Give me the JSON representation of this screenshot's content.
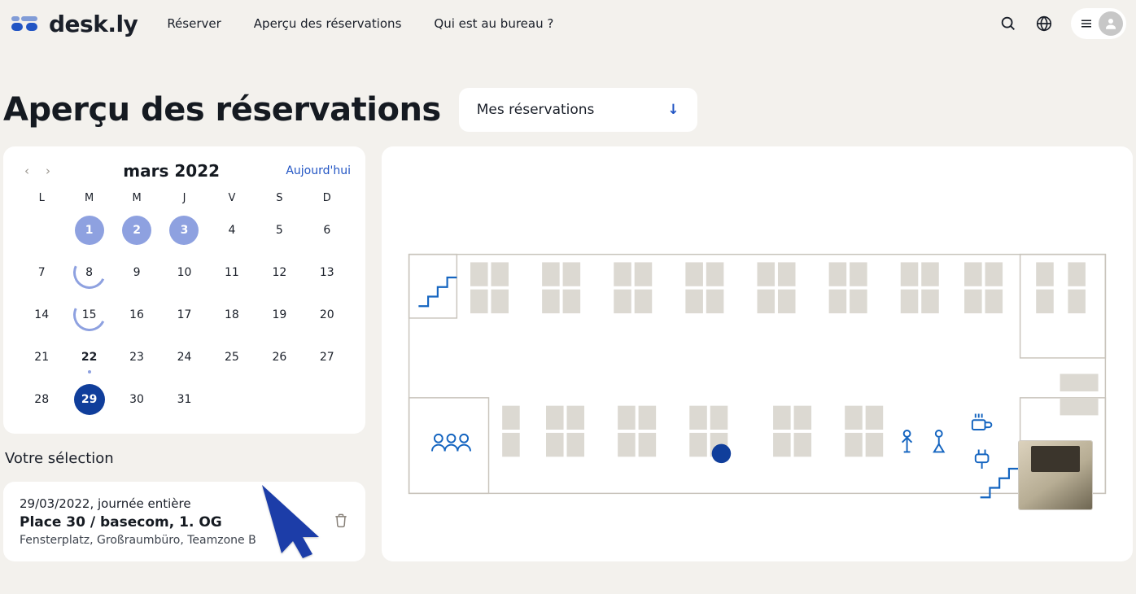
{
  "brand": {
    "name": "desk.ly"
  },
  "nav": {
    "reserve": "Réserver",
    "overview": "Aperçu des réservations",
    "who": "Qui est au bureau ?"
  },
  "page": {
    "title": "Aperçu des réservations",
    "filter_label": "Mes réservations"
  },
  "calendar": {
    "month_label": "mars 2022",
    "today_label": "Aujourd'hui",
    "dow": [
      "L",
      "M",
      "M",
      "J",
      "V",
      "S",
      "D"
    ],
    "weeks": [
      [
        {
          "n": "",
          "state": ""
        },
        {
          "n": "1",
          "state": "badge-soft"
        },
        {
          "n": "2",
          "state": "badge-soft"
        },
        {
          "n": "3",
          "state": "badge-soft"
        },
        {
          "n": "4",
          "state": ""
        },
        {
          "n": "5",
          "state": ""
        },
        {
          "n": "6",
          "state": ""
        }
      ],
      [
        {
          "n": "7",
          "state": ""
        },
        {
          "n": "8",
          "state": "ring"
        },
        {
          "n": "9",
          "state": ""
        },
        {
          "n": "10",
          "state": ""
        },
        {
          "n": "11",
          "state": ""
        },
        {
          "n": "12",
          "state": ""
        },
        {
          "n": "13",
          "state": ""
        }
      ],
      [
        {
          "n": "14",
          "state": ""
        },
        {
          "n": "15",
          "state": "ring"
        },
        {
          "n": "16",
          "state": ""
        },
        {
          "n": "17",
          "state": ""
        },
        {
          "n": "18",
          "state": ""
        },
        {
          "n": "19",
          "state": ""
        },
        {
          "n": "20",
          "state": ""
        }
      ],
      [
        {
          "n": "21",
          "state": ""
        },
        {
          "n": "22",
          "state": "bold dot"
        },
        {
          "n": "23",
          "state": ""
        },
        {
          "n": "24",
          "state": ""
        },
        {
          "n": "25",
          "state": ""
        },
        {
          "n": "26",
          "state": ""
        },
        {
          "n": "27",
          "state": ""
        }
      ],
      [
        {
          "n": "28",
          "state": ""
        },
        {
          "n": "29",
          "state": "selected"
        },
        {
          "n": "30",
          "state": ""
        },
        {
          "n": "31",
          "state": ""
        },
        {
          "n": "",
          "state": ""
        },
        {
          "n": "",
          "state": ""
        },
        {
          "n": "",
          "state": ""
        }
      ]
    ]
  },
  "selection": {
    "heading": "Votre sélection",
    "date_line": "29/03/2022, journée entière",
    "place_line": "Place 30 / basecom, 1. OG",
    "tags_line": "Fensterplatz, Großraumbüro, Teamzone B"
  },
  "floorplan": {
    "selected_desk": "desk-30"
  },
  "icons": {
    "search": "search-icon",
    "globe": "globe-icon",
    "menu": "menu-icon",
    "avatar": "avatar-icon",
    "trash": "trash-icon",
    "stairs": "stairs-icon",
    "people": "people-icon",
    "coffee": "coffee-icon",
    "plug": "plug-icon",
    "person_m": "person-male-icon",
    "person_f": "person-female-icon"
  }
}
